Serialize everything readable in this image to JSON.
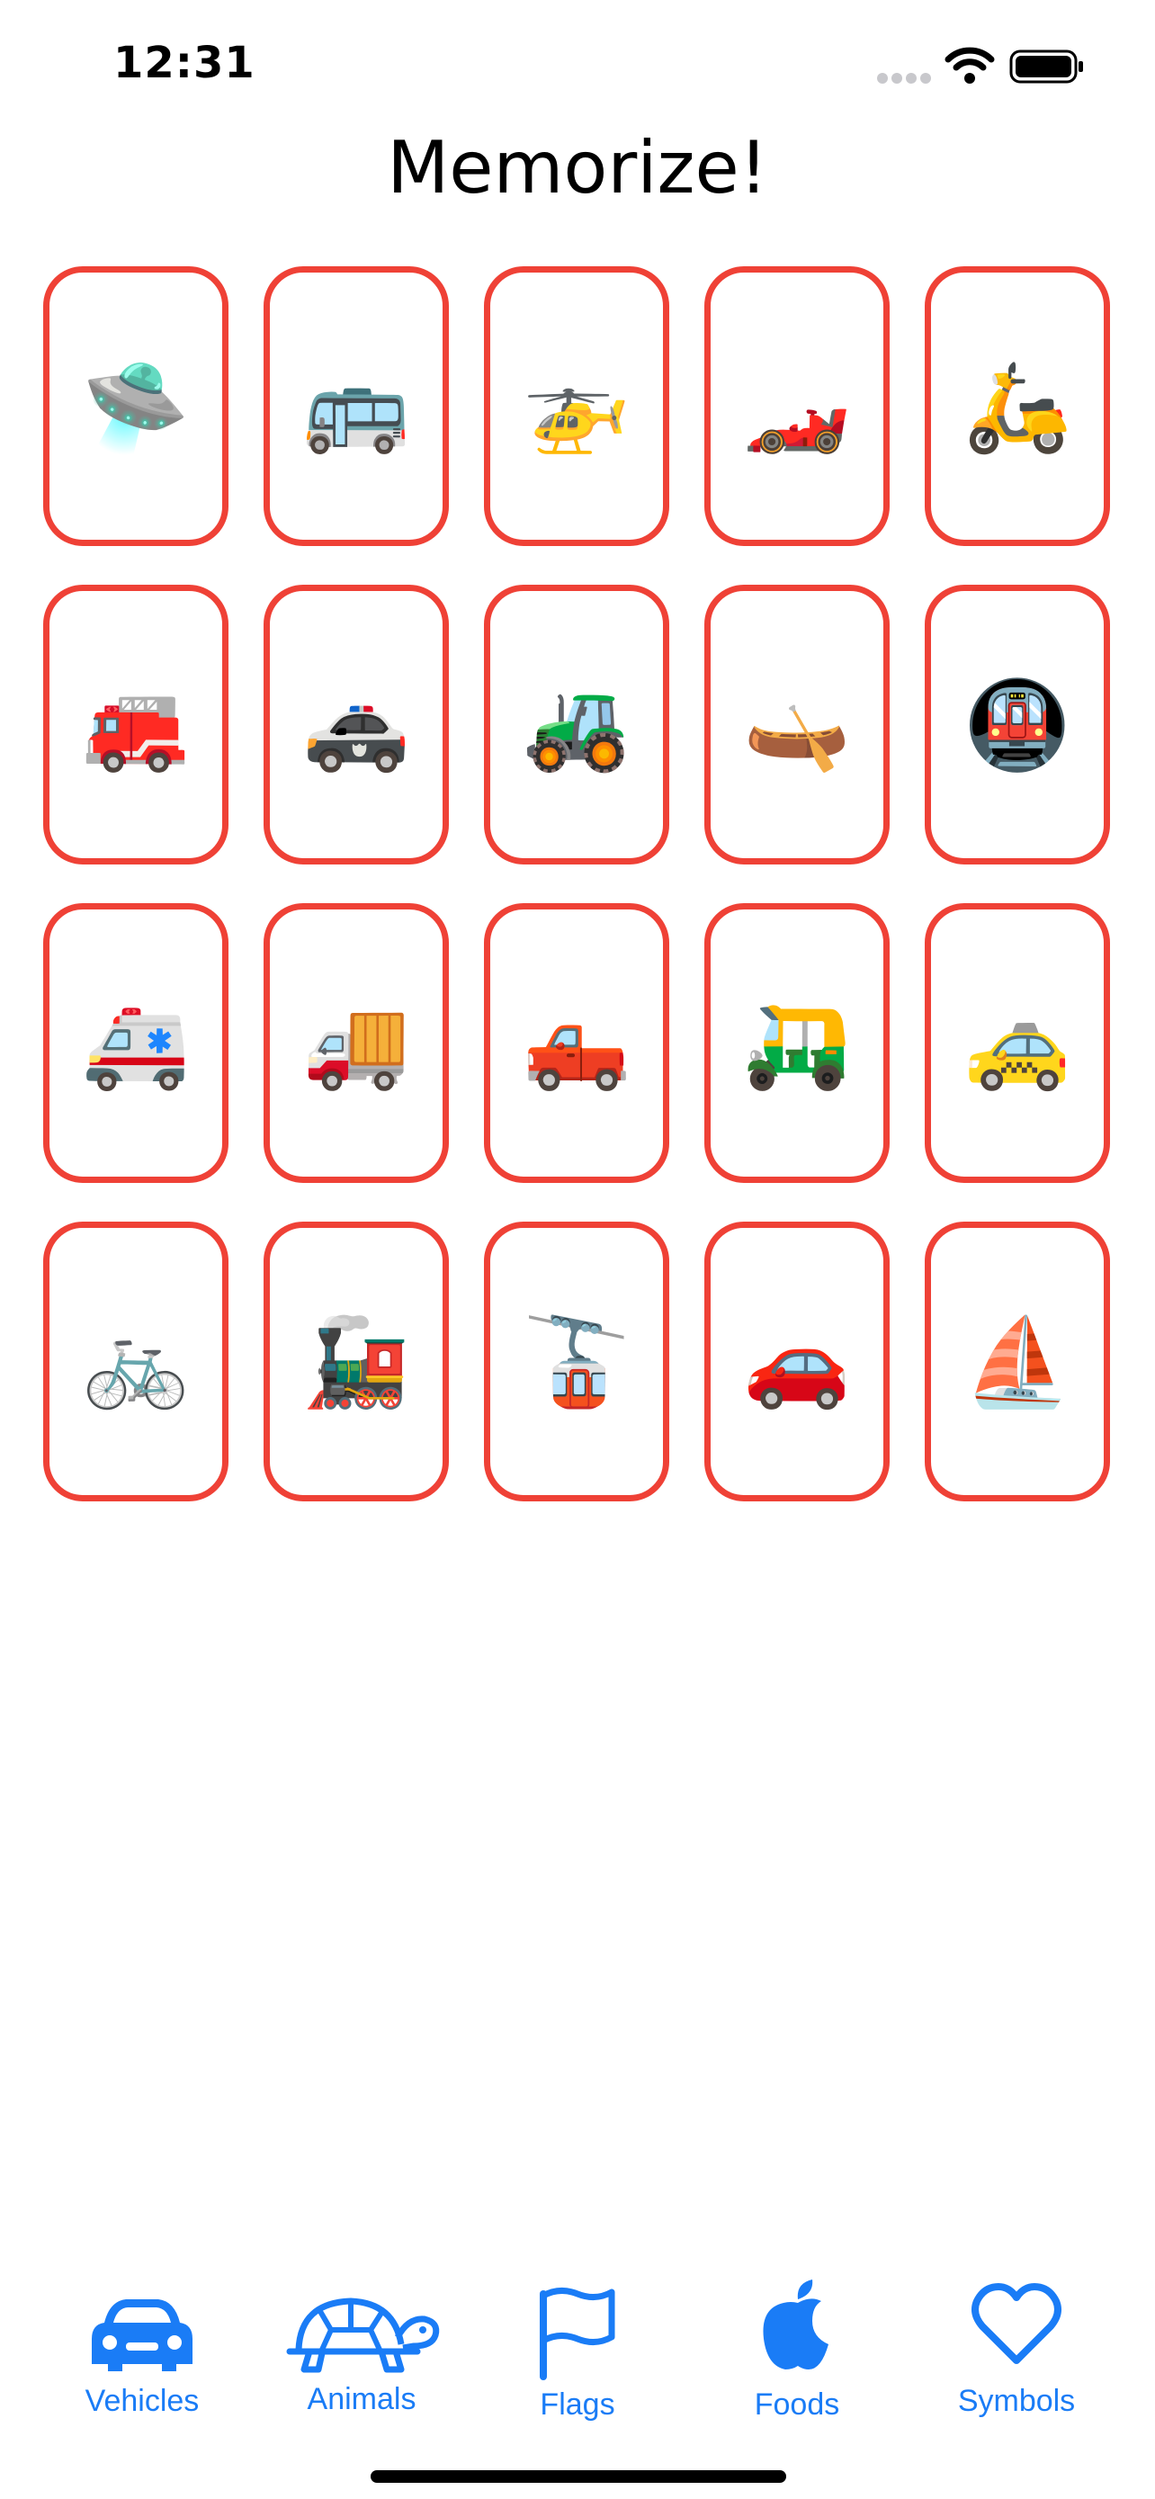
{
  "status": {
    "time": "12:31"
  },
  "title": "Memorize!",
  "cards": [
    {
      "emoji": "🛸"
    },
    {
      "emoji": "🚌"
    },
    {
      "emoji": "🚁"
    },
    {
      "emoji": "🏎️"
    },
    {
      "emoji": "🛵"
    },
    {
      "emoji": "🚒"
    },
    {
      "emoji": "🚓"
    },
    {
      "emoji": "🚜"
    },
    {
      "emoji": "🛶"
    },
    {
      "emoji": "🚇"
    },
    {
      "emoji": "🚑"
    },
    {
      "emoji": "🚚"
    },
    {
      "emoji": "🛻"
    },
    {
      "emoji": "🛺"
    },
    {
      "emoji": "🚕"
    },
    {
      "emoji": "🚲"
    },
    {
      "emoji": "🚂"
    },
    {
      "emoji": "🚡"
    },
    {
      "emoji": "🚗"
    },
    {
      "emoji": "⛵"
    }
  ],
  "card_border_color": "#ef4136",
  "accent_color": "#1a7cf6",
  "tabs": [
    {
      "label": "Vehicles",
      "icon": "car-icon"
    },
    {
      "label": "Animals",
      "icon": "tortoise-icon"
    },
    {
      "label": "Flags",
      "icon": "flag-icon"
    },
    {
      "label": "Foods",
      "icon": "apple-icon"
    },
    {
      "label": "Symbols",
      "icon": "heart-icon"
    }
  ]
}
